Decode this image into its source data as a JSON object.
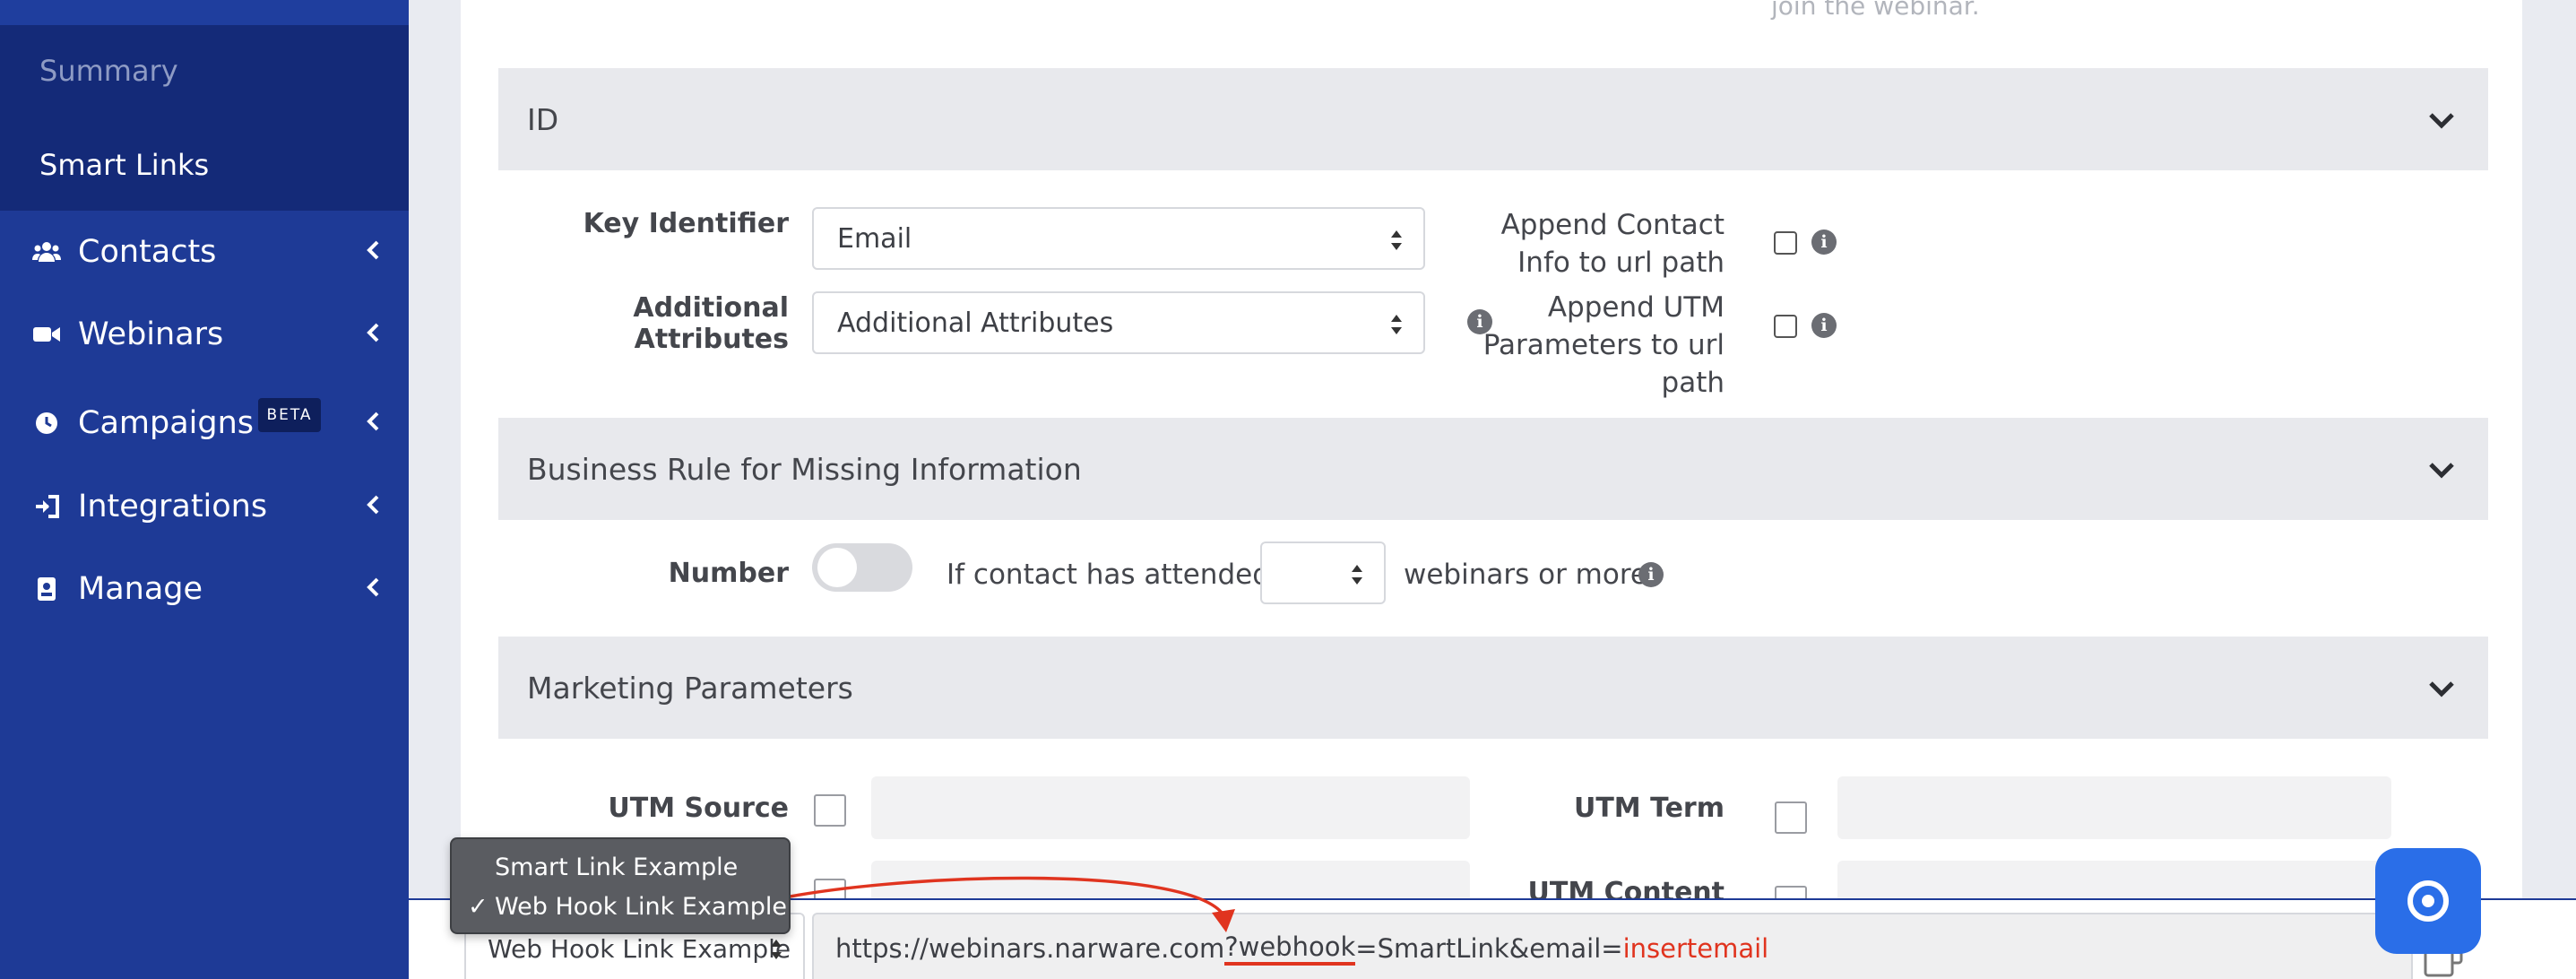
{
  "sidebar": {
    "sub_items": [
      "Summary",
      "Smart Links"
    ],
    "items": [
      {
        "label": "Contacts",
        "icon": "users-icon"
      },
      {
        "label": "Webinars",
        "icon": "video-icon"
      },
      {
        "label": "Campaigns",
        "icon": "clock-icon",
        "badge": "BETA"
      },
      {
        "label": "Integrations",
        "icon": "sign-in-icon"
      },
      {
        "label": "Manage",
        "icon": "id-badge-icon"
      }
    ]
  },
  "top_faded_text": "join the webinar.",
  "id_section": {
    "title": "ID",
    "key_identifier_label": "Key Identifier",
    "key_identifier_value": "Email",
    "additional_attributes_label": "Additional Attributes",
    "additional_attributes_value": "Additional Attributes",
    "append_contact_label": [
      "Append Contact",
      "Info to url path"
    ],
    "append_utm_label": [
      "Append UTM",
      "Parameters to url",
      "path"
    ]
  },
  "business_section": {
    "title": "Business Rule for Missing Information",
    "number_label": "Number",
    "attended_text": "If contact has attended",
    "webinars_text": "webinars or more."
  },
  "marketing_section": {
    "title": "Marketing Parameters",
    "utm_source_label": "UTM Source",
    "utm_term_label": "UTM Term",
    "utm_content_label": "UTM Content"
  },
  "example_dropdown": {
    "options": [
      "Smart Link Example",
      "Web Hook Link Example"
    ],
    "selected": "Web Hook Link Example"
  },
  "url": {
    "base": "https://webinars.narware.com",
    "underlined": "?webhook",
    "middle": "=SmartLink&email=",
    "highlighted": "insertemail"
  },
  "colors": {
    "sidebar": "#1e3a96",
    "accent_red": "#e0341f",
    "chat_button": "#2a6ee8"
  }
}
